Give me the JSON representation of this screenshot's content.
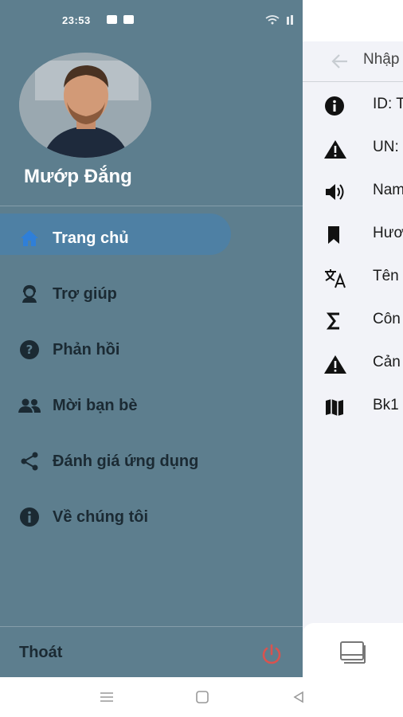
{
  "status_bar": {
    "time": "23:53"
  },
  "drawer": {
    "user_name": "Mướp Đắng",
    "items": [
      {
        "label": "Trang chủ",
        "icon": "home-icon",
        "active": true
      },
      {
        "label": "Trợ giúp",
        "icon": "support-agent-icon",
        "active": false
      },
      {
        "label": "Phản hồi",
        "icon": "help-circle-icon",
        "active": false
      },
      {
        "label": "Mời bạn bè",
        "icon": "people-icon",
        "active": false
      },
      {
        "label": "Đánh giá ứng dụng",
        "icon": "share-icon",
        "active": false
      },
      {
        "label": "Về chúng tôi",
        "icon": "info-icon",
        "active": false
      }
    ],
    "logout_label": "Thoát",
    "colors": {
      "background": "#5d7e8e",
      "active": "#4e80a4",
      "power": "#d9534f"
    }
  },
  "panel": {
    "title": "Nhập",
    "rows": [
      {
        "text": "ID: T",
        "icon": "info-icon"
      },
      {
        "text": "UN:",
        "icon": "warning-icon"
      },
      {
        "text": "Nam",
        "icon": "volume-icon"
      },
      {
        "text": "Hươ",
        "icon": "bookmark-icon"
      },
      {
        "text": "Tên",
        "icon": "translate-icon"
      },
      {
        "text": "Côn",
        "icon": "sigma-icon"
      },
      {
        "text": "Cản",
        "icon": "warning-icon"
      },
      {
        "text": "Bk1",
        "icon": "map-icon"
      }
    ]
  }
}
